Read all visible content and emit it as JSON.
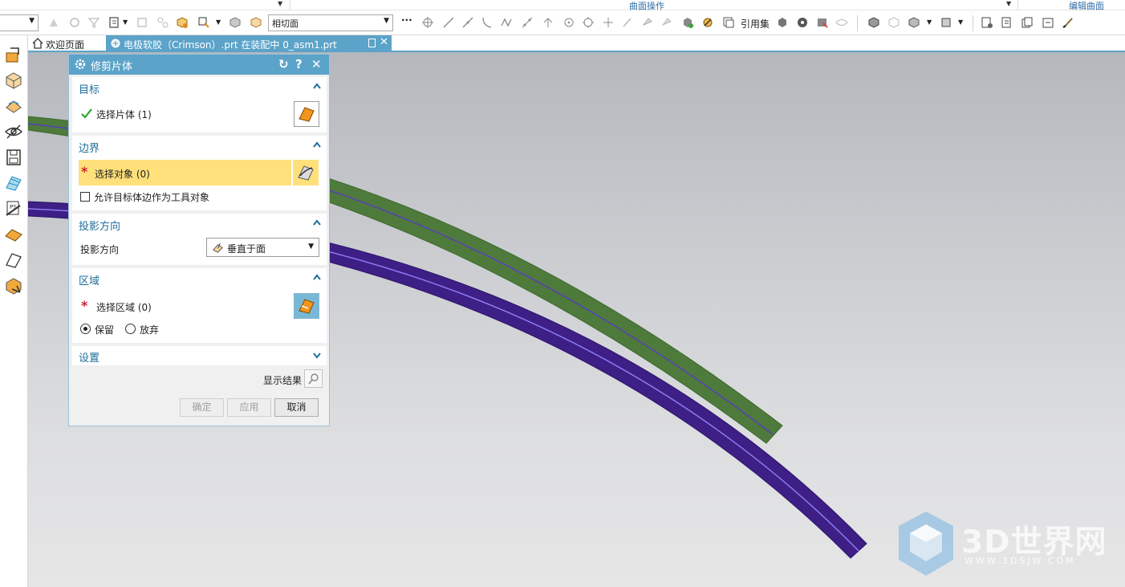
{
  "ribbon": {
    "group_surface_ops": "曲面操作",
    "group_edit_surface": "编辑曲面"
  },
  "toolbar": {
    "combo_value": "相切面",
    "reference_set_label": "引用集"
  },
  "tabs": {
    "welcome": "欢迎页面",
    "active": "电极软胶（Crimson）.prt 在装配中 0_asm1.prt"
  },
  "dialog": {
    "title": "修剪片体",
    "target": {
      "header": "目标",
      "select_sheet": "选择片体 (1)"
    },
    "boundary": {
      "header": "边界",
      "select_object": "选择对象 (0)",
      "allow_target_edges": "允许目标体边作为工具对象"
    },
    "projection": {
      "header": "投影方向",
      "label": "投影方向",
      "value": "垂直于面"
    },
    "region": {
      "header": "区域",
      "select_region": "选择区域 (0)",
      "keep": "保留",
      "discard": "放弃"
    },
    "settings": {
      "header": "设置"
    },
    "show_result": "显示结果",
    "buttons": {
      "ok": "确定",
      "apply": "应用",
      "cancel": "取消"
    }
  },
  "watermark": {
    "title": "3D世界网",
    "url": "WWW.3DSJW.COM"
  },
  "colors": {
    "accent": "#5ba3c9",
    "green_sheet": "#4e7a3c",
    "purple_sheet": "#3d1f86",
    "highlight_row": "#ffe07a",
    "required_star": "#d0202a",
    "check": "#2aa52a"
  }
}
